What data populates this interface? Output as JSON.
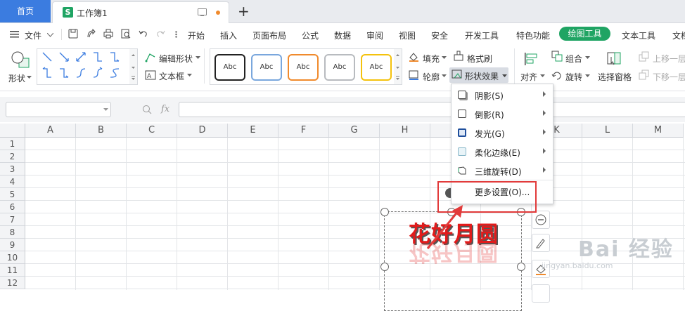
{
  "tabs": {
    "home": "首页",
    "document": "工作簿1",
    "doc_icon_letter": "S",
    "new_tab": "+"
  },
  "menu": {
    "file": "文件",
    "items": [
      "开始",
      "插入",
      "页面布局",
      "公式",
      "数据",
      "审阅",
      "视图",
      "安全",
      "开发工具",
      "特色功能"
    ],
    "active": "绘图工具",
    "text_tools": "文本工具",
    "more": "文档"
  },
  "ribbon": {
    "shape": "形状",
    "edit_shape": "编辑形状",
    "text_box": "文本框",
    "abc_styles": [
      "Abc",
      "Abc",
      "Abc",
      "Abc",
      "Abc"
    ],
    "fill": "填充",
    "format_painter": "格式刷",
    "outline": "轮廓",
    "shape_effects": "形状效果",
    "align": "对齐",
    "group": "组合",
    "rotate": "旋转",
    "selection_pane": "选择窗格",
    "bring_forward": "上移一层",
    "send_backward": "下移一层"
  },
  "formula": {
    "fx": "fx"
  },
  "columns": [
    "A",
    "B",
    "C",
    "D",
    "E",
    "F",
    "G",
    "H",
    "I",
    "J",
    "K",
    "L",
    "M"
  ],
  "rows": [
    "1",
    "2",
    "3",
    "4",
    "5",
    "6",
    "7",
    "8",
    "9",
    "10",
    "11",
    "12"
  ],
  "wordart": "花好月圆",
  "dropdown": {
    "items": [
      {
        "label": "阴影(S)",
        "submenu": true
      },
      {
        "label": "倒影(R)",
        "submenu": true
      },
      {
        "label": "发光(G)",
        "submenu": true
      },
      {
        "label": "柔化边缘(E)",
        "submenu": true
      },
      {
        "label": "三维旋转(D)",
        "submenu": true
      }
    ],
    "more_settings": "更多设置(O)..."
  },
  "watermark": {
    "main": "Bai 经验",
    "sub": "jingyan.baidu.com"
  },
  "colors": {
    "accent_green": "#1fa463",
    "home_blue": "#3b7ce0",
    "highlight_red": "#e23b3b",
    "wordart_red": "#e11b1b"
  }
}
